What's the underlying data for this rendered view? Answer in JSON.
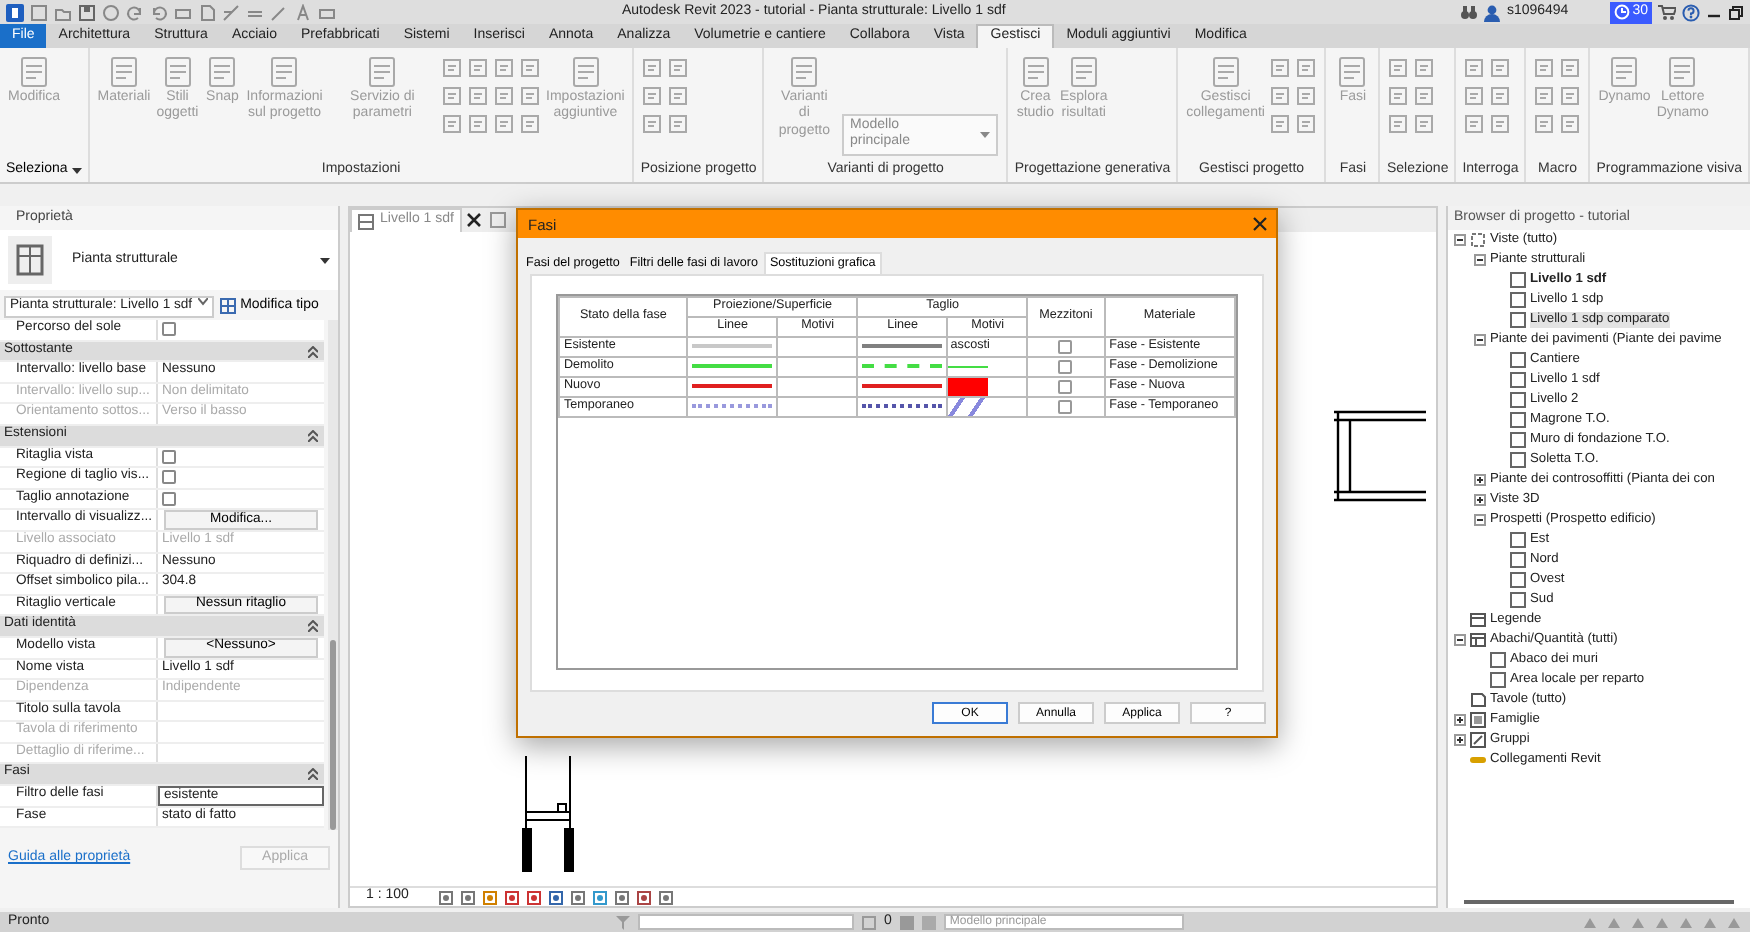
{
  "title_bar": {
    "title": "Autodesk Revit 2023 - tutorial - Pianta strutturale: Livello 1 sdf",
    "user": "s1096494",
    "timer": "30"
  },
  "menu_tabs": [
    {
      "label": "File",
      "kind": "file",
      "selected": false
    },
    {
      "label": "Architettura",
      "kind": "tab",
      "selected": false
    },
    {
      "label": "Struttura",
      "kind": "tab",
      "selected": false
    },
    {
      "label": "Acciaio",
      "kind": "tab",
      "selected": false
    },
    {
      "label": "Prefabbricati",
      "kind": "tab",
      "selected": false
    },
    {
      "label": "Sistemi",
      "kind": "tab",
      "selected": false
    },
    {
      "label": "Inserisci",
      "kind": "tab",
      "selected": false
    },
    {
      "label": "Annota",
      "kind": "tab",
      "selected": false
    },
    {
      "label": "Analizza",
      "kind": "tab",
      "selected": false
    },
    {
      "label": "Volumetrie e cantiere",
      "kind": "tab",
      "selected": false
    },
    {
      "label": "Collabora",
      "kind": "tab",
      "selected": false
    },
    {
      "label": "Vista",
      "kind": "tab",
      "selected": false
    },
    {
      "label": "Gestisci",
      "kind": "tab",
      "selected": true
    },
    {
      "label": "Moduli aggiuntivi",
      "kind": "tab",
      "selected": false
    },
    {
      "label": "Modifica",
      "kind": "tab",
      "selected": false
    }
  ],
  "ribbon_panels": [
    {
      "label": "Seleziona",
      "menu": true,
      "items": [
        {
          "kind": "large",
          "label": "Modifica"
        }
      ]
    },
    {
      "label": "Impostazioni",
      "menu": false,
      "items": [
        {
          "kind": "large",
          "label": "Materiali"
        },
        {
          "kind": "large",
          "label": "Stili\noggetti"
        },
        {
          "kind": "large",
          "label": "Snap"
        },
        {
          "kind": "large",
          "label": "Informazioni\nsul progetto"
        },
        {
          "kind": "large",
          "label": "Servizio di parametri"
        },
        {
          "kind": "icons"
        },
        {
          "kind": "icons"
        },
        {
          "kind": "large",
          "label": "Impostazioni\naggiuntive"
        }
      ]
    },
    {
      "label": "Posizione progetto",
      "menu": false,
      "items": [
        {
          "kind": "icons"
        }
      ]
    },
    {
      "label": "Varianti di progetto",
      "menu": false,
      "items": [
        {
          "kind": "large",
          "label": "Varianti\ndi progetto"
        },
        {
          "kind": "select",
          "value": "Modello principale"
        }
      ]
    },
    {
      "label": "Progettazione generativa",
      "menu": false,
      "items": [
        {
          "kind": "large",
          "label": "Crea\nstudio"
        },
        {
          "kind": "large",
          "label": "Esplora\nrisultati"
        }
      ]
    },
    {
      "label": "Gestisci progetto",
      "menu": false,
      "items": [
        {
          "kind": "large",
          "label": "Gestisci\ncollegamenti"
        },
        {
          "kind": "icons"
        }
      ]
    },
    {
      "label": "Fasi",
      "menu": false,
      "items": [
        {
          "kind": "large",
          "label": "Fasi"
        }
      ]
    },
    {
      "label": "Selezione",
      "menu": false,
      "items": [
        {
          "kind": "icons"
        }
      ]
    },
    {
      "label": "Interroga",
      "menu": false,
      "items": [
        {
          "kind": "icons"
        }
      ]
    },
    {
      "label": "Macro",
      "menu": false,
      "items": [
        {
          "kind": "icons"
        }
      ]
    },
    {
      "label": "Programmazione visiva",
      "menu": false,
      "items": [
        {
          "kind": "large",
          "label": "Dynamo"
        },
        {
          "kind": "large",
          "label": "Lettore\nDynamo"
        }
      ]
    }
  ],
  "properties": {
    "title": "Proprietà",
    "type_name": "Pianta strutturale",
    "instance": "Pianta strutturale: Livello 1 sdf",
    "edit_type": "Modifica tipo",
    "rows": [
      {
        "kind": "check",
        "label": "Percorso del sole",
        "checked": false,
        "disabled": false
      },
      {
        "kind": "group",
        "label": "Sottostante"
      },
      {
        "kind": "text",
        "label": "Intervallo: livello base",
        "value": "Nessuno",
        "disabled": false
      },
      {
        "kind": "text",
        "label": "Intervallo: livello sup...",
        "value": "Non delimitato",
        "disabled": true
      },
      {
        "kind": "text",
        "label": "Orientamento sottos...",
        "value": "Verso il basso",
        "disabled": true
      },
      {
        "kind": "group",
        "label": "Estensioni"
      },
      {
        "kind": "check",
        "label": "Ritaglia vista",
        "checked": false,
        "disabled": false
      },
      {
        "kind": "check",
        "label": "Regione di taglio vis...",
        "checked": false,
        "disabled": false
      },
      {
        "kind": "check",
        "label": "Taglio annotazione",
        "checked": false,
        "disabled": false
      },
      {
        "kind": "button",
        "label": "Intervallo di visualizz...",
        "value": "Modifica..."
      },
      {
        "kind": "text",
        "label": "Livello associato",
        "value": "Livello 1 sdf",
        "disabled": true
      },
      {
        "kind": "text",
        "label": "Riquadro di definizi...",
        "value": "Nessuno",
        "disabled": false
      },
      {
        "kind": "text",
        "label": "Offset simbolico pila...",
        "value": "304.8",
        "disabled": false
      },
      {
        "kind": "button",
        "label": "Ritaglio verticale",
        "value": "Nessun ritaglio"
      },
      {
        "kind": "group",
        "label": "Dati identità"
      },
      {
        "kind": "button",
        "label": "Modello vista",
        "value": "<Nessuno>"
      },
      {
        "kind": "text",
        "label": "Nome vista",
        "value": "Livello 1 sdf",
        "disabled": false
      },
      {
        "kind": "text",
        "label": "Dipendenza",
        "value": "Indipendente",
        "disabled": true
      },
      {
        "kind": "text",
        "label": "Titolo sulla tavola",
        "disabled": false
      },
      {
        "kind": "text",
        "label": "Tavola di riferimento",
        "disabled": true
      },
      {
        "kind": "text",
        "label": "Dettaglio di riferime...",
        "disabled": true
      },
      {
        "kind": "group",
        "label": "Fasi"
      },
      {
        "kind": "input",
        "label": "Filtro delle fasi",
        "value": "esistente"
      },
      {
        "kind": "text",
        "label": "Fase",
        "value": "stato di fatto",
        "disabled": false
      }
    ],
    "help_link": "Guida alle proprietà",
    "apply": "Applica"
  },
  "view": {
    "tabs": [
      {
        "label": "Livello 1 sdf",
        "selected": true
      }
    ],
    "scale": "1 : 100"
  },
  "dialog": {
    "title": "Fasi",
    "tabs": [
      {
        "label": "Fasi del progetto",
        "selected": false
      },
      {
        "label": "Filtri delle fasi di lavoro",
        "selected": false
      },
      {
        "label": "Sostituzioni grafica",
        "selected": true
      }
    ],
    "headers": {
      "state": "Stato della fase",
      "projection": "Proiezione/Superficie",
      "cut": "Taglio",
      "proj_lines": "Linee",
      "proj_patterns": "Motivi",
      "cut_lines": "Linee",
      "cut_patterns": "Motivi",
      "halftone": "Mezzitoni",
      "material": "Materiale"
    },
    "rows": [
      {
        "name": "Esistente",
        "proj_line": {
          "color": "#c8c8c8",
          "kind": "solid"
        },
        "cut_line": {
          "color": "#808080",
          "kind": "solid"
        },
        "cut_pattern": {
          "kind": "text",
          "text": "ascosti"
        },
        "halftone": false,
        "material": "Fase - Esistente"
      },
      {
        "name": "Demolito",
        "proj_line": {
          "color": "#44dd44",
          "kind": "solid"
        },
        "cut_line": {
          "color": "#44dd44",
          "kind": "dashed"
        },
        "cut_pattern": {
          "kind": "line",
          "color": "#44dd44"
        },
        "halftone": false,
        "material": "Fase - Demolizione"
      },
      {
        "name": "Nuovo",
        "proj_line": {
          "color": "#e02020",
          "kind": "solid"
        },
        "cut_line": {
          "color": "#e02020",
          "kind": "solid"
        },
        "cut_pattern": {
          "kind": "fill",
          "color": "#ff0000"
        },
        "halftone": false,
        "material": "Fase - Nuova"
      },
      {
        "name": "Temporaneo",
        "proj_line": {
          "color": "#9999dd",
          "kind": "dotted"
        },
        "cut_line": {
          "color": "#5555aa",
          "kind": "dotted"
        },
        "cut_pattern": {
          "kind": "hatch",
          "color": "#8888dd"
        },
        "halftone": false,
        "material": "Fase - Temporaneo"
      }
    ],
    "buttons": [
      {
        "label": "OK",
        "kind": "default"
      },
      {
        "label": "Annulla",
        "kind": "normal"
      },
      {
        "label": "Applica",
        "kind": "normal"
      },
      {
        "label": "?",
        "kind": "normal"
      }
    ]
  },
  "browser": {
    "title": "Browser di progetto - tutorial",
    "tree": [
      {
        "label": "Viste (tutto)",
        "kind": "views",
        "expanded": true,
        "selected": false,
        "current": false,
        "children": [
          {
            "label": "Piante strutturali",
            "kind": "category",
            "expanded": true,
            "selected": false,
            "current": false,
            "children": [
              {
                "label": "Livello 1 sdf",
                "kind": "view",
                "selected": false,
                "current": true
              },
              {
                "label": "Livello 1 sdp",
                "kind": "view",
                "selected": false,
                "current": false
              },
              {
                "label": "Livello 1 sdp comparato",
                "kind": "view",
                "selected": true,
                "current": false
              }
            ]
          },
          {
            "label": "Piante dei pavimenti (Piante dei pavime",
            "kind": "category",
            "expanded": true,
            "selected": false,
            "current": false,
            "children": [
              {
                "label": "Cantiere",
                "kind": "view",
                "selected": false,
                "current": false
              },
              {
                "label": "Livello 1 sdf",
                "kind": "view",
                "selected": false,
                "current": false
              },
              {
                "label": "Livello 2",
                "kind": "view",
                "selected": false,
                "current": false
              },
              {
                "label": "Magrone T.O.",
                "kind": "view",
                "selected": false,
                "current": false
              },
              {
                "label": "Muro di fondazione T.O.",
                "kind": "view",
                "selected": false,
                "current": false
              },
              {
                "label": "Soletta T.O.",
                "kind": "view",
                "selected": false,
                "current": false
              }
            ]
          },
          {
            "label": "Piante dei controsoffitti (Pianta dei con",
            "kind": "category",
            "expanded": false,
            "selected": false,
            "current": false
          },
          {
            "label": "Viste 3D",
            "kind": "category",
            "expanded": false,
            "selected": false,
            "current": false
          },
          {
            "label": "Prospetti (Prospetto edificio)",
            "kind": "category",
            "expanded": true,
            "selected": false,
            "current": false,
            "children": [
              {
                "label": "Est",
                "kind": "view",
                "selected": false,
                "current": false
              },
              {
                "label": "Nord",
                "kind": "view",
                "selected": false,
                "current": false
              },
              {
                "label": "Ovest",
                "kind": "view",
                "selected": false,
                "current": false
              },
              {
                "label": "Sud",
                "kind": "view",
                "selected": false,
                "current": false
              }
            ]
          }
        ]
      },
      {
        "label": "Legende",
        "kind": "legend",
        "selected": false,
        "current": false
      },
      {
        "label": "Abachi/Quantità (tutti)",
        "kind": "schedule",
        "expanded": true,
        "selected": false,
        "current": false,
        "children": [
          {
            "label": "Abaco dei muri",
            "kind": "view",
            "selected": false,
            "current": false
          },
          {
            "label": "Area locale per reparto",
            "kind": "view",
            "selected": false,
            "current": false
          }
        ]
      },
      {
        "label": "Tavole (tutto)",
        "kind": "sheet",
        "selected": false,
        "current": false
      },
      {
        "label": "Famiglie",
        "kind": "family",
        "expanded": false,
        "selected": false,
        "current": false
      },
      {
        "label": "Gruppi",
        "kind": "groups",
        "expanded": false,
        "selected": false,
        "current": false
      },
      {
        "label": "Collegamenti Revit",
        "kind": "link",
        "selected": false,
        "current": false
      }
    ]
  },
  "status_bar": {
    "status": "Pronto",
    "count": "0",
    "model": "Modello principale"
  }
}
